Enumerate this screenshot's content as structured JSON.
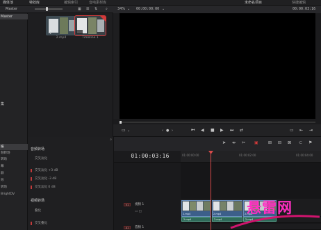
{
  "topbar": {
    "items": [
      "媒体池",
      "特效库",
      "编辑索引",
      "音响素材库"
    ],
    "project_name": "未命名项目",
    "right_item": "快捷编辑"
  },
  "toolbar": {
    "bin_label": "Master",
    "zoom": "34%",
    "timecode_left": "00:00:00:00",
    "timecode_right": "00:00:03:16"
  },
  "bins": {
    "items": [
      {
        "label": "Master",
        "selected": true
      },
      {
        "label": "",
        "selected": false
      }
    ],
    "section2_label": "集"
  },
  "media_pool": {
    "clips": [
      {
        "label": "2.mp4",
        "selected": false
      },
      {
        "label": "Timeline 1",
        "selected": true
      }
    ]
  },
  "effects": {
    "tree": [
      {
        "label": "编",
        "selected": true
      },
      {
        "label": "频转场",
        "selected": false
      },
      {
        "label": "转场",
        "selected": false
      },
      {
        "label": "幕",
        "selected": false
      },
      {
        "label": "器",
        "selected": false
      },
      {
        "label": "效",
        "selected": false
      },
      {
        "label": "转场",
        "selected": false
      },
      {
        "label": "BrightDV",
        "selected": false
      }
    ],
    "sections": [
      {
        "title": "音频转场",
        "items": [
          {
            "label": "交叉淡化",
            "marked": false
          },
          {
            "label": "交叉淡化 +3 dB",
            "marked": true
          },
          {
            "label": "交叉淡化 -3 dB",
            "marked": true
          },
          {
            "label": "交叉淡化 0 dB",
            "marked": true
          }
        ]
      },
      {
        "title": "视频转场",
        "items": [
          {
            "label": "叠化",
            "marked": false
          },
          {
            "label": "交叉叠化",
            "marked": true
          }
        ]
      }
    ]
  },
  "timeline": {
    "timecode": "01:00:03:16",
    "ruler_ticks": [
      "01:00:00:00",
      "01:00:02:00",
      "01:00:04:00"
    ],
    "video_track": {
      "badge": "V1",
      "name": "视频 1"
    },
    "audio_track": {
      "badge": "A1",
      "name": "音频 1"
    },
    "clips": [
      {
        "label": "2.mp4"
      },
      {
        "label": "2.mp4"
      },
      {
        "label": "2.mp4"
      }
    ]
  },
  "watermark": "悬雷网",
  "colors": {
    "accent": "#d43a3a",
    "clip_video": "#3c5f8a",
    "clip_audio": "#2f6b5a",
    "watermark": "#ff2fc2"
  }
}
